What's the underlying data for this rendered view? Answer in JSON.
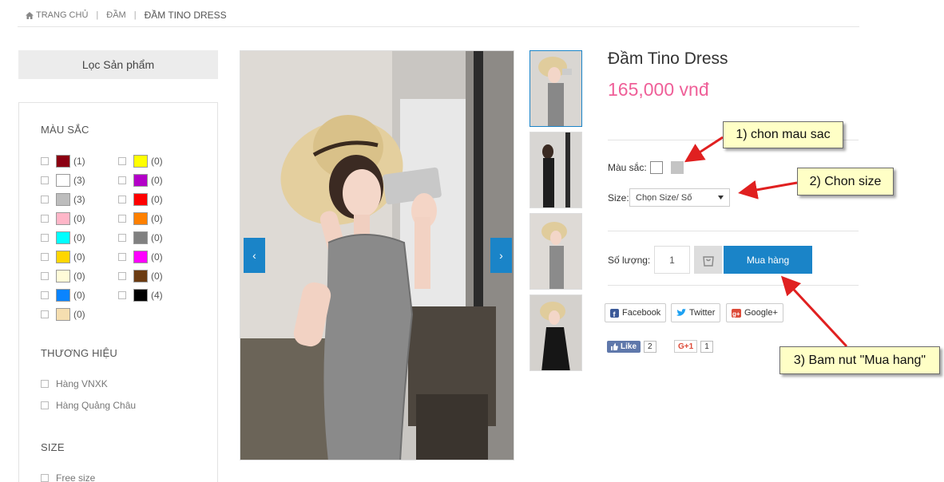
{
  "breadcrumb": {
    "home": "TRANG CHỦ",
    "category": "ĐẦM",
    "current": "ĐẦM TINO DRESS",
    "sep": "|"
  },
  "sidebar": {
    "filter_label": "Lọc Sản phẩm",
    "color_title": "MÀU SẮC",
    "colors_left": [
      {
        "color": "#8b0012",
        "count": "(1)"
      },
      {
        "color": "#ffffff",
        "count": "(3)"
      },
      {
        "color": "#bdbdbd",
        "count": "(3)"
      },
      {
        "color": "#ffb6c8",
        "count": "(0)"
      },
      {
        "color": "#00ffff",
        "count": "(0)"
      },
      {
        "color": "#ffd600",
        "count": "(0)"
      },
      {
        "color": "#fffbd8",
        "count": "(0)"
      },
      {
        "color": "#0a84ff",
        "count": "(0)"
      },
      {
        "color": "#f5deb0",
        "count": "(0)"
      }
    ],
    "colors_right": [
      {
        "color": "#ffff00",
        "count": "(0)"
      },
      {
        "color": "#b300c8",
        "count": "(0)"
      },
      {
        "color": "#ff0000",
        "count": "(0)"
      },
      {
        "color": "#ff8000",
        "count": "(0)"
      },
      {
        "color": "#808080",
        "count": "(0)"
      },
      {
        "color": "#ff00ff",
        "count": "(0)"
      },
      {
        "color": "#6b3b12",
        "count": "(0)"
      },
      {
        "color": "#000000",
        "count": "(4)"
      }
    ],
    "brand_title": "THƯƠNG HIỆU",
    "brands": [
      "Hàng VNXK",
      "Hàng Quảng Châu"
    ],
    "size_title": "SIZE",
    "sizes": [
      "Free size"
    ]
  },
  "gallery": {
    "prev": "‹",
    "next": "›",
    "thumb_count": 4
  },
  "product": {
    "name": "Đầm Tino Dress",
    "price": "165,000 vnđ",
    "color_label": "Màu sắc:",
    "size_label": "Size:",
    "size_select": "Chọn Size/ Số",
    "qty_label": "Số lượng:",
    "qty_value": "1",
    "buy_label": "Mua hàng"
  },
  "social": {
    "facebook": "Facebook",
    "twitter": "Twitter",
    "google": "Google+",
    "like_label": "Like",
    "like_count": "2",
    "gplus_label": "G+1",
    "gplus_count": "1"
  },
  "annotations": {
    "step1": "1) chon mau sac",
    "step2": "2) Chon size",
    "step3": "3) Bam nut \"Mua hang\""
  }
}
